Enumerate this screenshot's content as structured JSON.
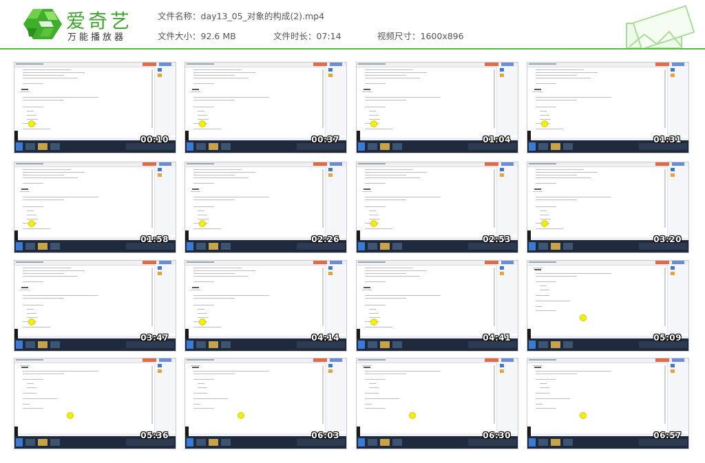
{
  "app": {
    "logo_name": "爱奇艺",
    "logo_sub": "万能播放器",
    "brand_color": "#41a430",
    "accent_line_color": "#58b947"
  },
  "file_info": {
    "name_label": "文件名称：",
    "name_value": "day13_05_对象的构成(2).mp4",
    "size_label": "文件大小：",
    "size_value": "92.6 MB",
    "duration_label": "文件时长：",
    "duration_value": "07:14",
    "resolution_label": "视频尺寸：",
    "resolution_value": "1600x896"
  },
  "thumbnails": [
    {
      "time": "00:10"
    },
    {
      "time": "00:37"
    },
    {
      "time": "01:04"
    },
    {
      "time": "01:31"
    },
    {
      "time": "01:58"
    },
    {
      "time": "02:26"
    },
    {
      "time": "02:53"
    },
    {
      "time": "03:20"
    },
    {
      "time": "03:47"
    },
    {
      "time": "04:14"
    },
    {
      "time": "04:41"
    },
    {
      "time": "05:09"
    },
    {
      "time": "05:36"
    },
    {
      "time": "06:03"
    },
    {
      "time": "06:30"
    },
    {
      "time": "06:57"
    }
  ]
}
